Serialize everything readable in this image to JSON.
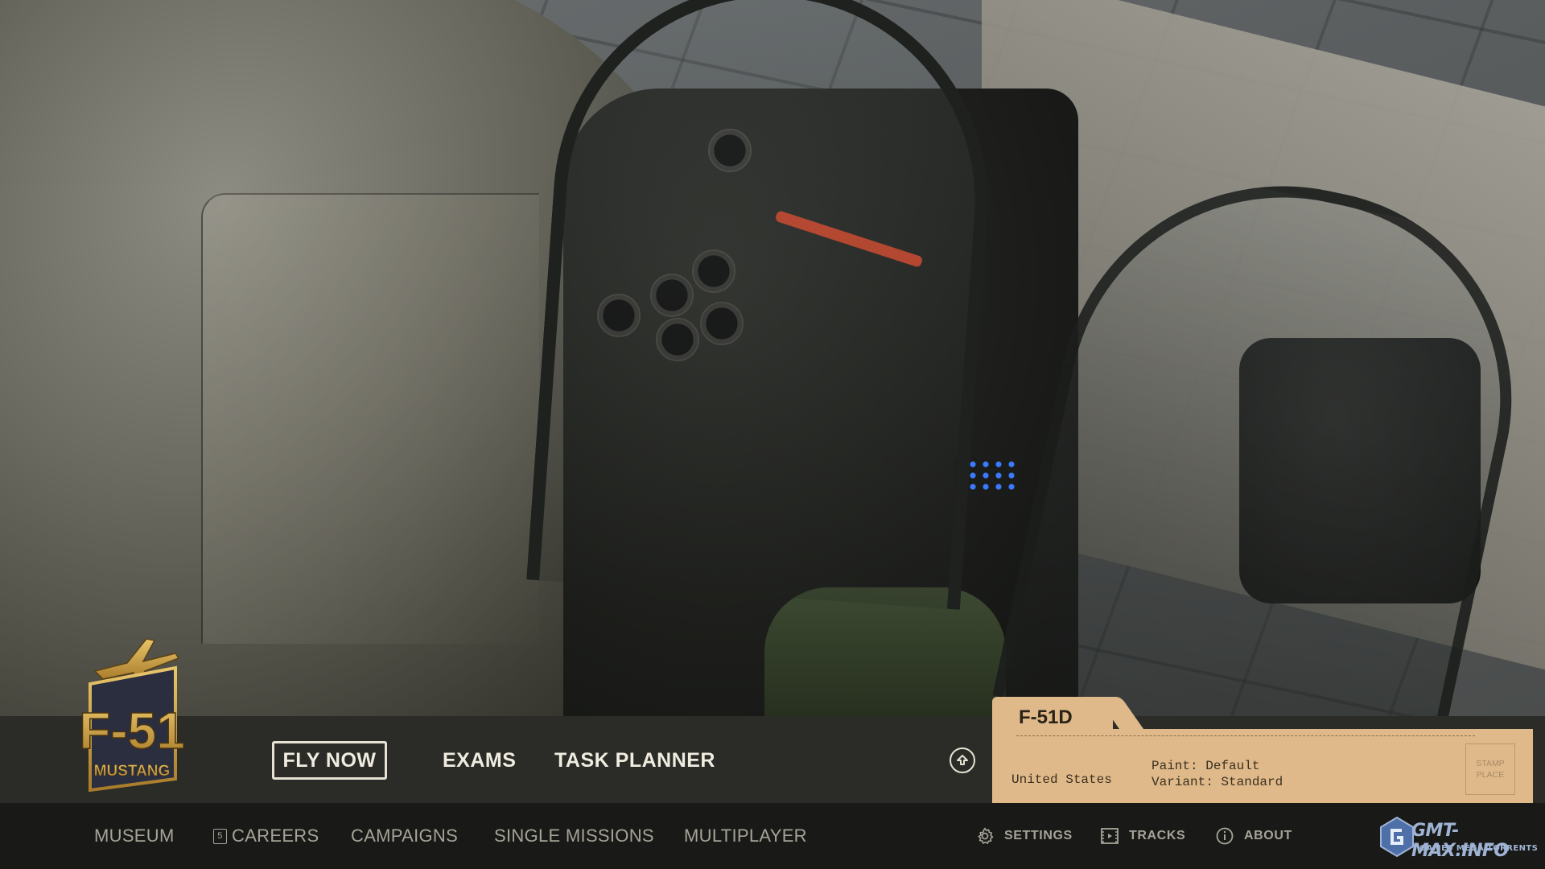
{
  "logo": {
    "line1": "F-51",
    "line2": "MUSTANG"
  },
  "main_menu": {
    "fly_now": "FLY NOW",
    "exams": "EXAMS",
    "task_planner": "TASK PLANNER"
  },
  "aircraft_card": {
    "title": "F-51D",
    "country": "United States",
    "paint": "Paint: Default",
    "variant": "Variant: Standard",
    "stamp_line1": "STAMP",
    "stamp_line2": "PLACE"
  },
  "bottom_nav": {
    "museum": "MUSEUM",
    "careers_badge": "5",
    "careers": "CAREERS",
    "campaigns": "CAMPAIGNS",
    "single_missions": "SINGLE MISSIONS",
    "multiplayer": "MULTIPLAYER",
    "settings": "SETTINGS",
    "tracks": "TRACKS",
    "about": "ABOUT"
  },
  "watermark": {
    "line1": "GMT-MAX.INFO",
    "line2": "GAMES MEGA TORRENTS"
  },
  "colors": {
    "top_bar": "#2b2c27",
    "bottom_bar": "#191a17",
    "card": "#e0b98a",
    "logo_gold": "#c9a24a",
    "logo_navy": "#2a2e3f"
  }
}
